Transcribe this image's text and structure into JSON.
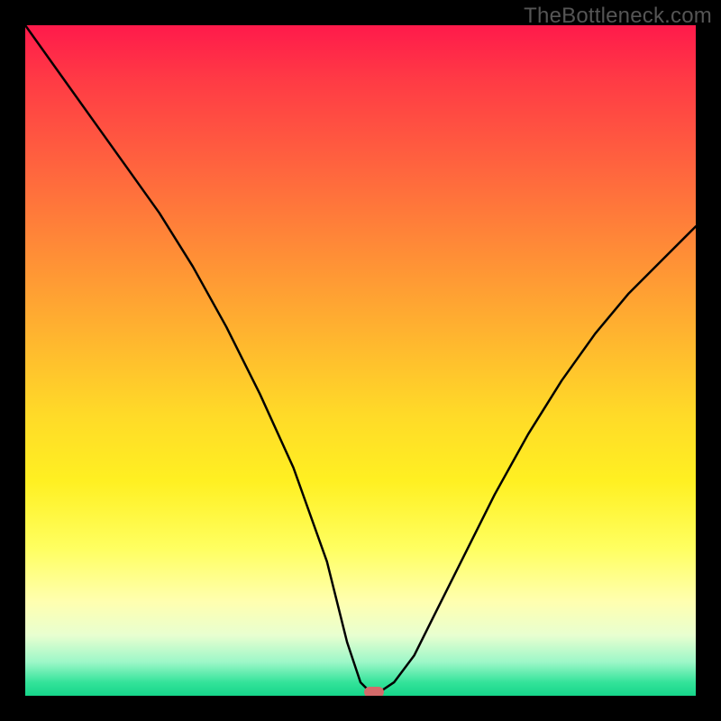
{
  "watermark": "TheBottleneck.com",
  "colors": {
    "frame": "#000000",
    "curve": "#000000",
    "marker": "#d46a6a"
  },
  "chart_data": {
    "type": "line",
    "title": "",
    "xlabel": "",
    "ylabel": "",
    "xlim": [
      0,
      100
    ],
    "ylim": [
      0,
      100
    ],
    "x": [
      0,
      5,
      10,
      15,
      20,
      25,
      30,
      35,
      40,
      45,
      48,
      50,
      52,
      55,
      58,
      61,
      65,
      70,
      75,
      80,
      85,
      90,
      95,
      100
    ],
    "values": [
      100,
      93,
      86,
      79,
      72,
      64,
      55,
      45,
      34,
      20,
      8,
      2,
      0,
      2,
      6,
      12,
      20,
      30,
      39,
      47,
      54,
      60,
      65,
      70
    ],
    "marker": {
      "x": 52,
      "y": 0
    },
    "description": "V-shaped bottleneck curve on rainbow gradient background; minimum near x≈52 at y≈0. Left branch descends from (0,100) steeply; right branch rises to about (100,70)."
  }
}
